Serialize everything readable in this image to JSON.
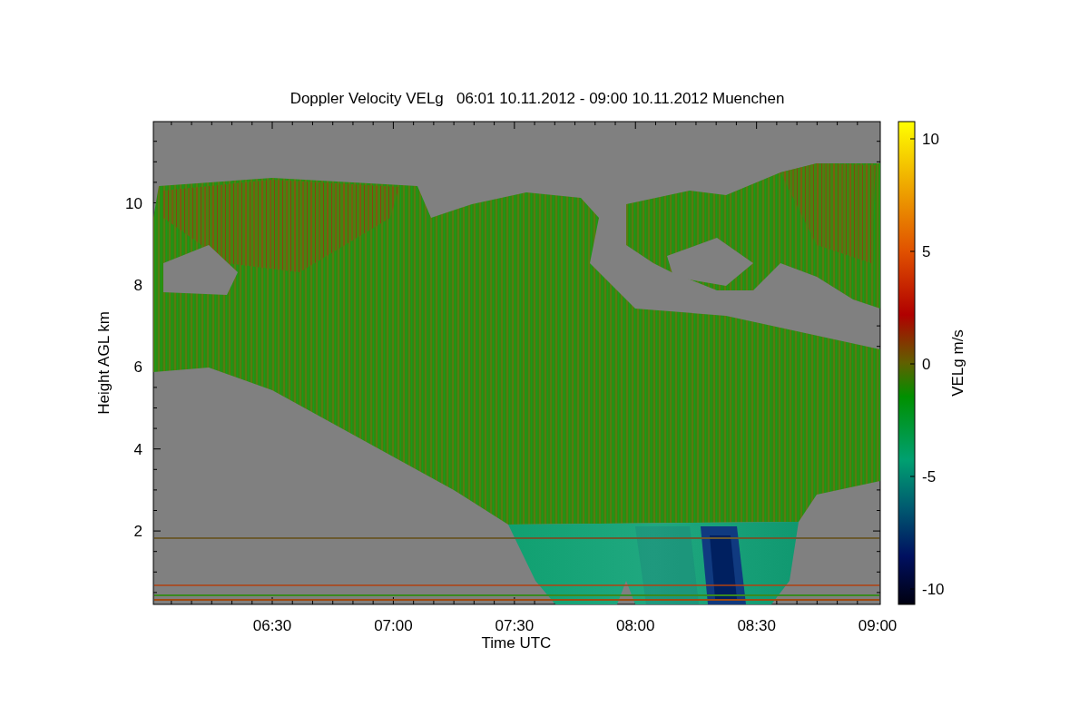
{
  "plot": {
    "title": "Doppler Velocity VELg   06:01 10.11.2012 - 09:00 10.11.2012 Muenchen",
    "xlabel": "Time UTC",
    "ylabel": "Height AGL km",
    "xticks": [
      "06:30",
      "07:00",
      "07:30",
      "08:00",
      "08:30",
      "09:00"
    ],
    "yticks": [
      "10",
      "8",
      "6",
      "4",
      "2"
    ]
  },
  "colorbar": {
    "label": "VELg m/s",
    "ticks": [
      "10",
      "5",
      "0",
      "-5",
      "-10"
    ]
  }
}
